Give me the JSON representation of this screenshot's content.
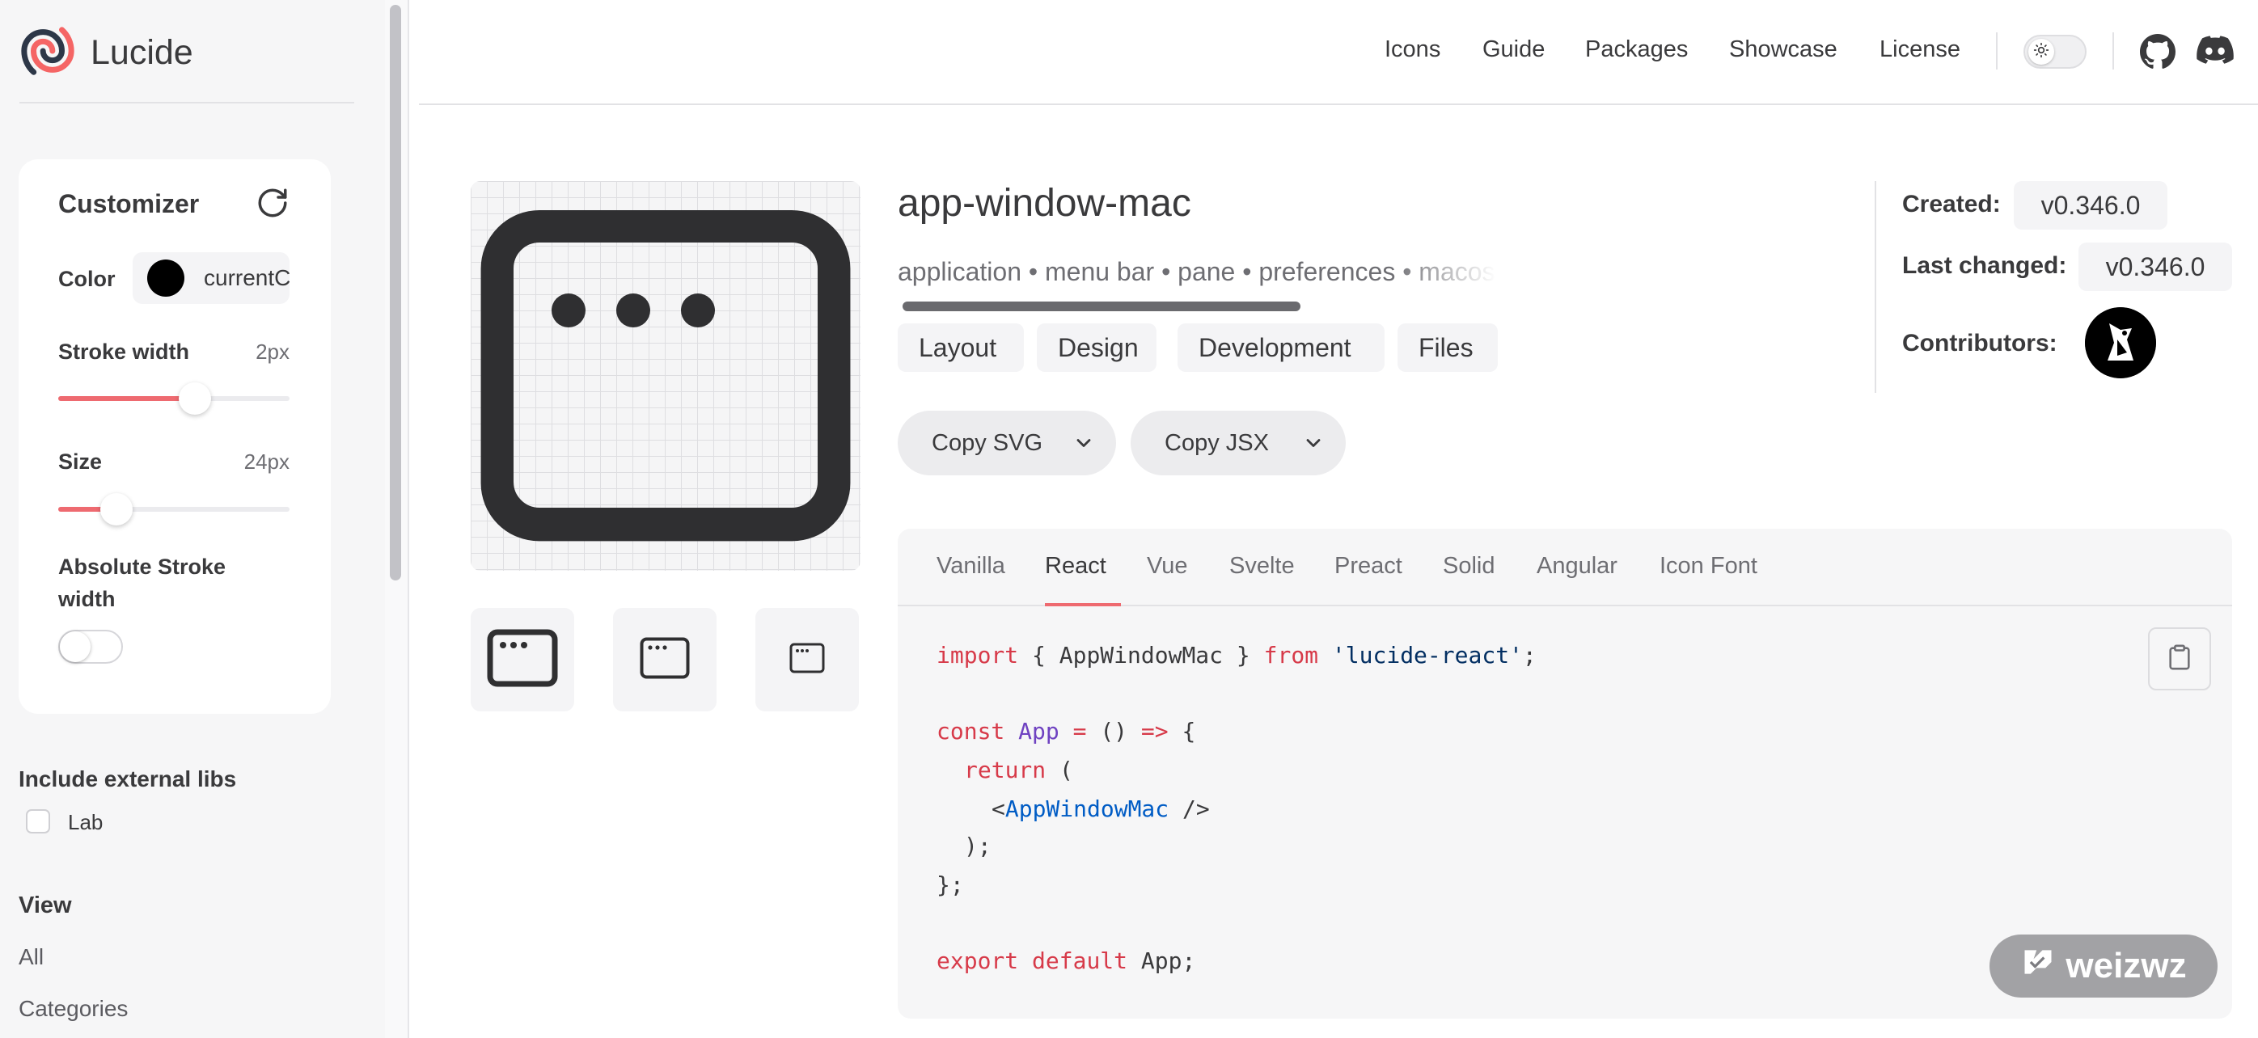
{
  "app": {
    "brand": "Lucide"
  },
  "nav": {
    "links": [
      "Icons",
      "Guide",
      "Packages",
      "Showcase",
      "License"
    ]
  },
  "customizer": {
    "title": "Customizer",
    "color_label": "Color",
    "color_value": "currentColor",
    "stroke_label": "Stroke width",
    "stroke_value": "2px",
    "stroke_fraction": 0.59,
    "size_label": "Size",
    "size_value": "24px",
    "size_fraction": 0.25,
    "absolute_line1": "Absolute Stroke",
    "absolute_line2": "width",
    "absolute_enabled": false
  },
  "external_libs": {
    "title": "Include external libs",
    "options": [
      {
        "label": "Lab",
        "checked": false
      }
    ]
  },
  "view": {
    "title": "View",
    "items": [
      "All",
      "Categories"
    ]
  },
  "icon": {
    "name": "app-window-mac",
    "tags": "application • menu bar • pane • preferences • macos • osx",
    "categories": [
      "Layout",
      "Design",
      "Development",
      "Files"
    ],
    "copy_svg": "Copy SVG",
    "copy_jsx": "Copy JSX"
  },
  "meta": {
    "created_label": "Created:",
    "created_value": "v0.346.0",
    "changed_label": "Last changed:",
    "changed_value": "v0.346.0",
    "contributors_label": "Contributors:"
  },
  "code": {
    "tabs": [
      "Vanilla",
      "React",
      "Vue",
      "Svelte",
      "Preact",
      "Solid",
      "Angular",
      "Icon Font"
    ],
    "active_tab": "React",
    "t_import": "import",
    "t_braces_open": " { ",
    "t_component": "AppWindowMac",
    "t_braces_close": " } ",
    "t_from": "from",
    "t_space": " ",
    "t_pkg": "'lucide-react'",
    "t_semicolon": ";",
    "t_const": "const",
    "t_app": "App",
    "t_eq": " = ",
    "t_parens": "() ",
    "t_arrow": "=>",
    "t_brace": " {",
    "t_return": "return",
    "t_open_paren": " (",
    "t_lt": "<",
    "t_self_close": " />",
    "t_close_paren": ");",
    "t_close_brace": "};",
    "t_export": "export",
    "t_default": "default",
    "t_app_semicolon": "App;"
  },
  "watermark": {
    "text": "weizwz"
  },
  "colors": {
    "accent": "#ee6a70",
    "sidebar_bg": "#f6f6f7",
    "text": "#3a3a3c"
  },
  "icons": [
    "lucide-logo",
    "reset-icon",
    "sun-icon",
    "github-icon",
    "discord-icon",
    "chevron-down-icon",
    "clipboard-icon"
  ]
}
